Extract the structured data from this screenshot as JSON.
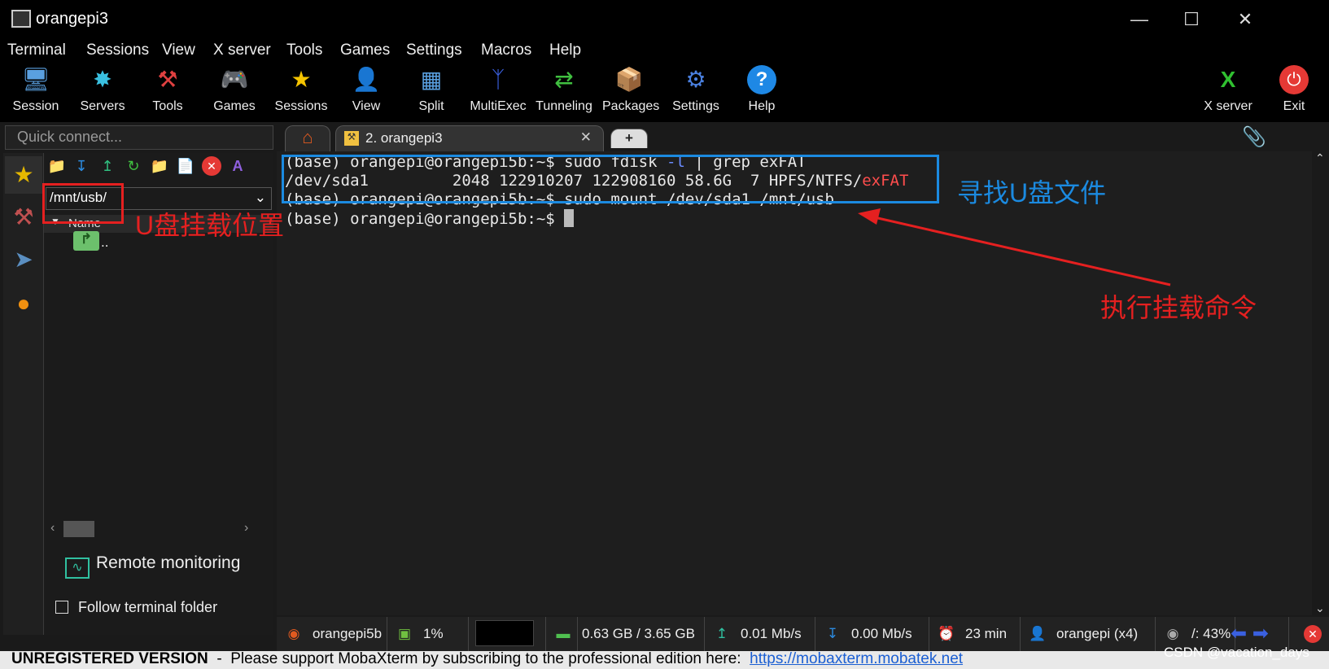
{
  "window": {
    "title": "orangepi3",
    "minimize_icon": "minimize-icon",
    "maximize_icon": "maximize-icon",
    "close_icon": "close-icon"
  },
  "menu": [
    "Terminal",
    "Sessions",
    "View",
    "X server",
    "Tools",
    "Games",
    "Settings",
    "Macros",
    "Help"
  ],
  "toolbar": {
    "items": [
      "Session",
      "Servers",
      "Tools",
      "Games",
      "Sessions",
      "View",
      "Split",
      "MultiExec",
      "Tunneling",
      "Packages",
      "Settings",
      "Help"
    ],
    "right": [
      "X server",
      "Exit"
    ]
  },
  "sidebar": {
    "quick_connect_placeholder": "Quick connect...",
    "path": "/mnt/usb/",
    "column": "Name",
    "parent_entry": "..",
    "remote_monitoring": "Remote monitoring",
    "follow_folder": "Follow terminal folder"
  },
  "tabs": {
    "home_icon": "home-icon",
    "session_tab": "2. orangepi3",
    "new_tab_icon": "plus-icon"
  },
  "terminal": {
    "prompt": "(base) orangepi@orangepi5b:~$ ",
    "cmd1_a": "sudo fdisk ",
    "cmd1_flag": "-l",
    "cmd1_b": " | grep exFAT",
    "out1_a": "/dev/sda1         2048 122910207 122908160 58.6G  7 HPFS/NTFS/",
    "out1_hl": "exFAT",
    "cmd2": "sudo mount /dev/sda1 /mnt/usb"
  },
  "annotations": {
    "find_usb": "寻找U盘文件",
    "mount_pos": "U盘挂载位置",
    "mount_cmd": "执行挂载命令",
    "colors": {
      "red": "#e52020",
      "blue": "#1b8ae0"
    }
  },
  "status": {
    "host": "orangepi5b",
    "cpu": "1%",
    "mem": "0.63 GB / 3.65 GB",
    "up": "0.01 Mb/s",
    "down": "0.00 Mb/s",
    "uptime": "23 min",
    "user": "orangepi (x4)",
    "disk": "/: 43%"
  },
  "footer": {
    "unregistered": "UNREGISTERED VERSION",
    "sep": "  -  ",
    "message": "Please support MobaXterm by subscribing to the professional edition here:  ",
    "link": "https://mobaxterm.mobatek.net",
    "watermark": "CSDN @vacation_days"
  }
}
